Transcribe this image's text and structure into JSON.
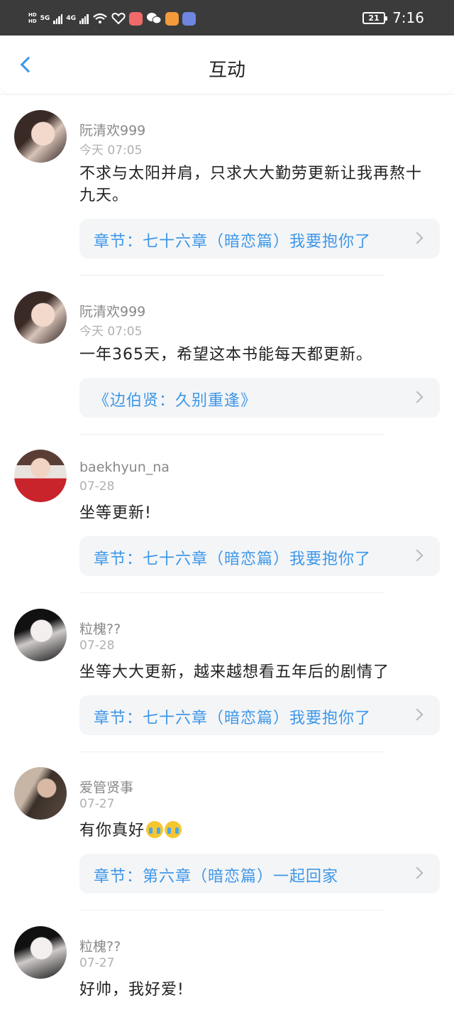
{
  "status_bar": {
    "left_labels": [
      "HD",
      "5G",
      "HD",
      "4G"
    ],
    "battery_level": "21",
    "time": "7:16",
    "app_icons": [
      "signal-icon",
      "wifi-icon",
      "health-icon",
      "mail-app-icon",
      "wechat-icon",
      "video-app-icon",
      "music-app-icon"
    ]
  },
  "header": {
    "title": "互动"
  },
  "colors": {
    "accent": "#3d97e8",
    "status_bar": "#3b3b3b",
    "chapter_bg": "#f4f5f7"
  },
  "comments": [
    {
      "username": "阮清欢999",
      "time": "今天 07:05",
      "content": "不求与太阳并肩，只求大大勤劳更新让我再熬十九天。",
      "chapter": "章节：七十六章（暗恋篇）我要抱你了"
    },
    {
      "username": "阮清欢999",
      "time": "今天 07:05",
      "content": "一年365天，希望这本书能每天都更新。",
      "chapter": "《边伯贤：久别重逢》"
    },
    {
      "username": "baekhyun_na",
      "time": "07-28",
      "content": "坐等更新!",
      "chapter": "章节：七十六章（暗恋篇）我要抱你了"
    },
    {
      "username": "粒槐??",
      "time": "07-28",
      "content": "坐等大大更新，越来越想看五年后的剧情了",
      "chapter": "章节：七十六章（暗恋篇）我要抱你了"
    },
    {
      "username": "爱管贤事",
      "time": "07-27",
      "content": "有你真好",
      "emoji": "crying-face-emoji",
      "chapter": "章节：第六章（暗恋篇）一起回家"
    },
    {
      "username": "粒槐??",
      "time": "07-27",
      "content": "好帅，我好爱!"
    }
  ]
}
